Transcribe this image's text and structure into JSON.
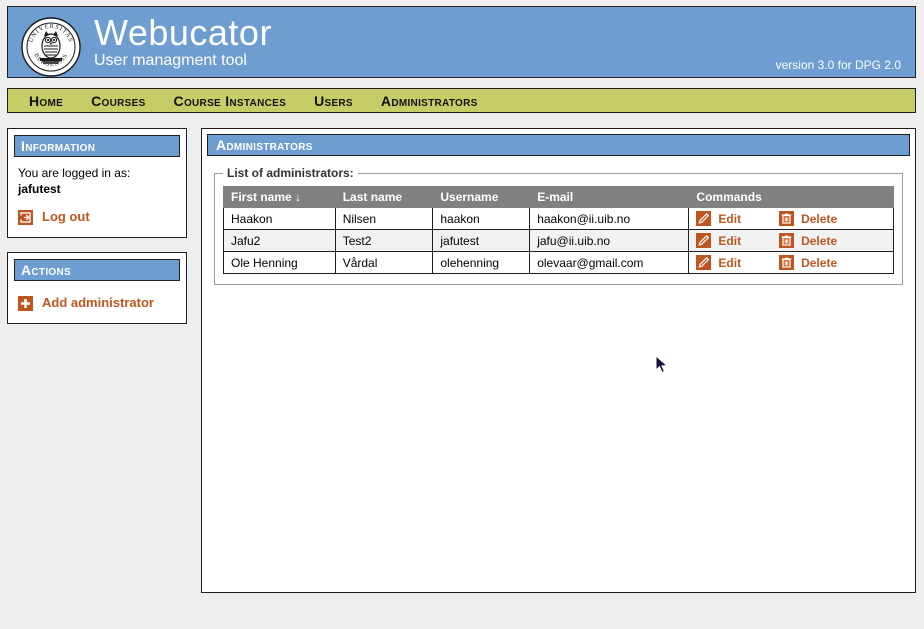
{
  "header": {
    "app_title": "Webucator",
    "app_subtitle": "User managment tool",
    "version": "version 3.0 for DPG 2.0",
    "logo_alt": "University of Bergen seal - UNIVERSITAS BERGENSIS",
    "banner_color": "#6d9dd1"
  },
  "nav": {
    "items": [
      {
        "label": "Home",
        "name": "nav-home"
      },
      {
        "label": "Courses",
        "name": "nav-courses"
      },
      {
        "label": "Course Instances",
        "name": "nav-course-instances"
      },
      {
        "label": "Users",
        "name": "nav-users"
      },
      {
        "label": "Administrators",
        "name": "nav-administrators"
      }
    ],
    "bar_color": "#c7cd66"
  },
  "sidebar": {
    "information": {
      "title": "Information",
      "logged_in_text": "You are logged in as:",
      "username": "jafutest",
      "logout_label": "Log out"
    },
    "actions": {
      "title": "Actions",
      "add_admin_label": "Add administrator"
    },
    "link_color": "#c0561f"
  },
  "main": {
    "title": "Administrators",
    "fieldset_legend": "List of administrators:",
    "table": {
      "columns": [
        {
          "label": "First name",
          "sort_indicator": "↓"
        },
        {
          "label": "Last name",
          "sort_indicator": ""
        },
        {
          "label": "Username",
          "sort_indicator": ""
        },
        {
          "label": "E-mail",
          "sort_indicator": ""
        },
        {
          "label": "Commands",
          "sort_indicator": ""
        }
      ],
      "header_bg": "#808080",
      "rows": [
        {
          "first_name": "Haakon",
          "last_name": "Nilsen",
          "username": "haakon",
          "email": "haakon@ii.uib.no",
          "edit_label": "Edit",
          "delete_label": "Delete"
        },
        {
          "first_name": "Jafu2",
          "last_name": "Test2",
          "username": "jafutest",
          "email": "jafu@ii.uib.no",
          "edit_label": "Edit",
          "delete_label": "Delete"
        },
        {
          "first_name": "Ole Henning",
          "last_name": "Vårdal",
          "username": "olehenning",
          "email": "olevaar@gmail.com",
          "edit_label": "Edit",
          "delete_label": "Delete"
        }
      ]
    }
  },
  "icons": {
    "logout": "logout-icon",
    "add": "plus-icon",
    "edit": "pencil-icon",
    "delete": "trash-icon",
    "cursor": "mouse-pointer"
  }
}
